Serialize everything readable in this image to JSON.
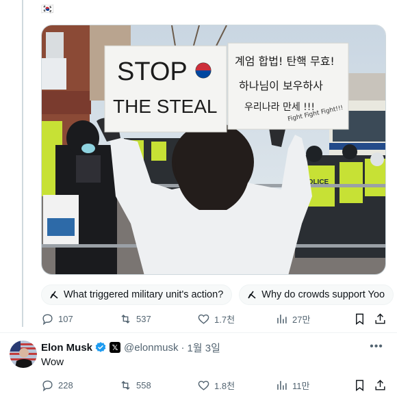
{
  "quoted_post": {
    "flag_emoji": "🇰🇷",
    "media": {
      "sign_left": {
        "line1": "STOP",
        "line2": "THE STEAL"
      },
      "sign_right": {
        "line1": "계엄 합법! 탄핵 무효!",
        "line2": "하나님이 보우하사",
        "line3": "우리나라 만세 !!!",
        "line4": "Fight Fight Fight!!!"
      },
      "police_vest_text": "POLICE"
    },
    "chips": [
      {
        "label": "What triggered military unit's action?",
        "icon": "grok-icon"
      },
      {
        "label": "Why do crowds support Yoo",
        "icon": "grok-icon"
      }
    ],
    "actions": {
      "replies": "107",
      "reposts": "537",
      "likes": "1.7천",
      "views": "27만"
    }
  },
  "reply": {
    "author": "Elon Musk",
    "affiliation_badge": "𝕏",
    "handle": "@elonmusk",
    "separator": "·",
    "date": "1월 3일",
    "text": "Wow",
    "actions": {
      "replies": "228",
      "reposts": "558",
      "likes": "1.8천",
      "views": "11만"
    }
  },
  "colors": {
    "text_secondary": "#536471",
    "verified_blue": "#1d9bf0",
    "border": "#cfd9de"
  }
}
